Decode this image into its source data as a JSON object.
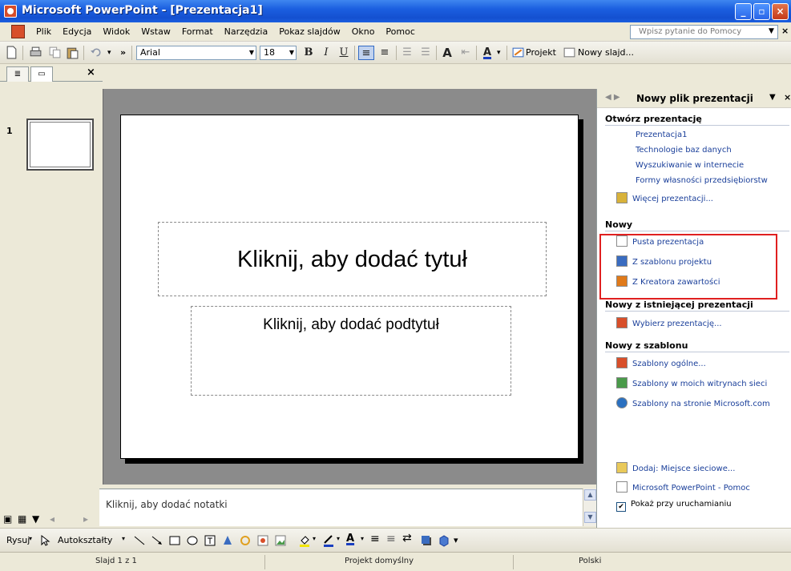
{
  "window": {
    "title": "Microsoft PowerPoint - [Prezentacja1]",
    "min": "_",
    "max": "▫",
    "close": "×"
  },
  "menu": {
    "items": [
      "Plik",
      "Edycja",
      "Widok",
      "Wstaw",
      "Format",
      "Narzędzia",
      "Pokaz slajdów",
      "Okno",
      "Pomoc"
    ],
    "help_placeholder": "Wpisz pytanie do Pomocy",
    "close": "×"
  },
  "toolbar": {
    "font": "Arial",
    "size": "18",
    "bold": "B",
    "italic": "I",
    "underline": "U",
    "grow_font": "A",
    "font_color": "A",
    "design_label": "Projekt",
    "new_slide_label": "Nowy slajd...",
    "more": "»"
  },
  "left_tabs": {
    "outline": "≣",
    "slides": "▭",
    "close": "×"
  },
  "slides": [
    {
      "number": "1"
    }
  ],
  "slide": {
    "title_placeholder": "Kliknij, aby dodać tytuł",
    "subtitle_placeholder": "Kliknij, aby dodać podtytuł"
  },
  "notes_placeholder": "Kliknij, aby dodać notatki",
  "task_pane": {
    "title": "Nowy plik prezentacji",
    "sections": {
      "open": {
        "title": "Otwórz prezentację",
        "items": [
          "Prezentacja1",
          "Technologie baz danych",
          "Wyszukiwanie w internecie",
          "Formy własności przedsiębiorstw"
        ],
        "more": "Więcej prezentacji..."
      },
      "new": {
        "title": "Nowy",
        "items": [
          "Pusta prezentacja",
          "Z szablonu projektu",
          "Z Kreatora zawartości"
        ]
      },
      "from_existing": {
        "title": "Nowy z istniejącej prezentacji",
        "items": [
          "Wybierz prezentację..."
        ]
      },
      "from_template": {
        "title": "Nowy z szablonu",
        "items": [
          "Szablony ogólne...",
          "Szablony w moich witrynach sieci",
          "Szablony na stronie Microsoft.com"
        ]
      },
      "bottom": {
        "add_place": "Dodaj: Miejsce sieciowe...",
        "help": "Microsoft PowerPoint - Pomoc",
        "show_on_start": "Pokaż przy uruchamianiu",
        "show_on_start_checked": true
      }
    }
  },
  "draw_toolbar": {
    "draw": "Rysuj",
    "autoshapes": "Autokształty"
  },
  "status": {
    "slide": "Slajd 1 z 1",
    "design": "Projekt domyślny",
    "language": "Polski"
  },
  "colors": {
    "titlebar": "#1b5fe0",
    "highlight": "#e02020",
    "link": "#1a3f9a"
  }
}
